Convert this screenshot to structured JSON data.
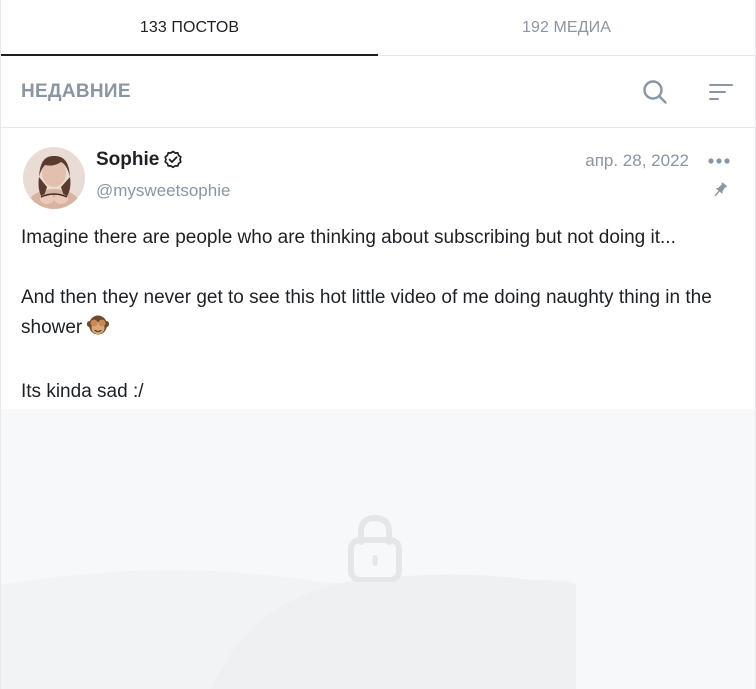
{
  "tabs": [
    {
      "label": "133 ПОСТОВ",
      "active": true
    },
    {
      "label": "192 МЕДИА",
      "active": false
    }
  ],
  "section": {
    "title": "НЕДАВНИЕ",
    "search_icon": "search-icon",
    "sort_icon": "sort-icon"
  },
  "post": {
    "author": {
      "name": "Sophie",
      "handle": "@mysweetsophie",
      "verified": true
    },
    "date": "апр. 28, 2022",
    "pinned": true,
    "paragraphs": [
      "Imagine there are people who are thinking about subscribing but not doing it...",
      "And then they never get to see this hot little video of me doing naughty thing in the shower",
      "Its kinda sad :/"
    ],
    "emoji": "see-no-evil-monkey",
    "media_locked": true
  },
  "colors": {
    "text": "#1d2125",
    "muted": "#8a96a3",
    "border": "#e6e8ea",
    "locked_bg": "#f7f8f9"
  }
}
